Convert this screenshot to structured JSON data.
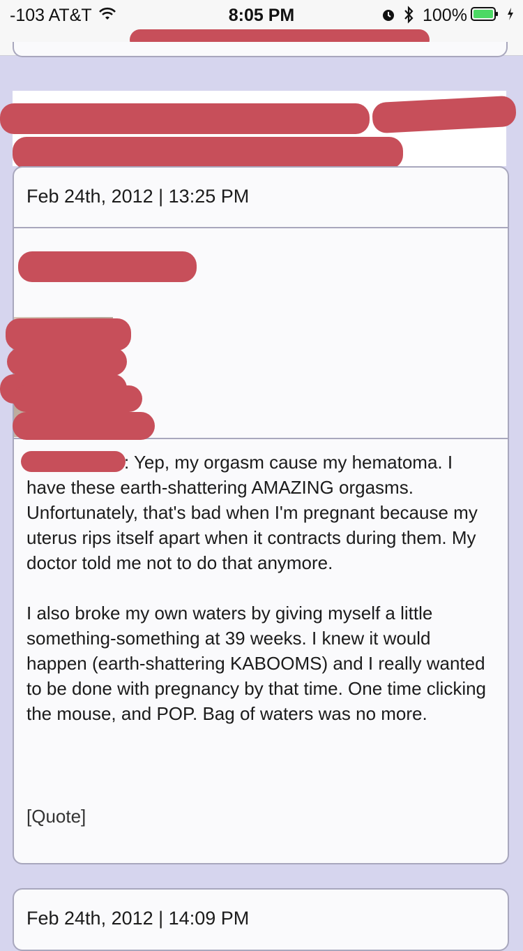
{
  "status_bar": {
    "carrier": "-103 AT&T",
    "time": "8:05 PM",
    "battery": "100%"
  },
  "post": {
    "date": "Feb 24th, 2012 | 13:25 PM",
    "body_lead": ": Yep, my orgasm cause my hematoma. I have these earth-shattering AMAZING orgasms. Unfortunately, that's bad when I'm pregnant because my uterus rips itself apart when it contracts during them. My doctor told me not to do that anymore.",
    "body_second": "I also broke my own waters by giving myself a little something-something at 39 weeks. I knew it would happen (earth-shattering KABOOMS) and I really wanted to be done with pregnancy by that time. One time clicking the mouse, and POP. Bag of waters was no more.",
    "quote_label": "[Quote]"
  },
  "next_post": {
    "date": "Feb 24th, 2012 | 14:09 PM"
  },
  "colors": {
    "background": "#d6d5ee",
    "redaction": "#c74f5a",
    "card_border": "#a8a7bd"
  }
}
